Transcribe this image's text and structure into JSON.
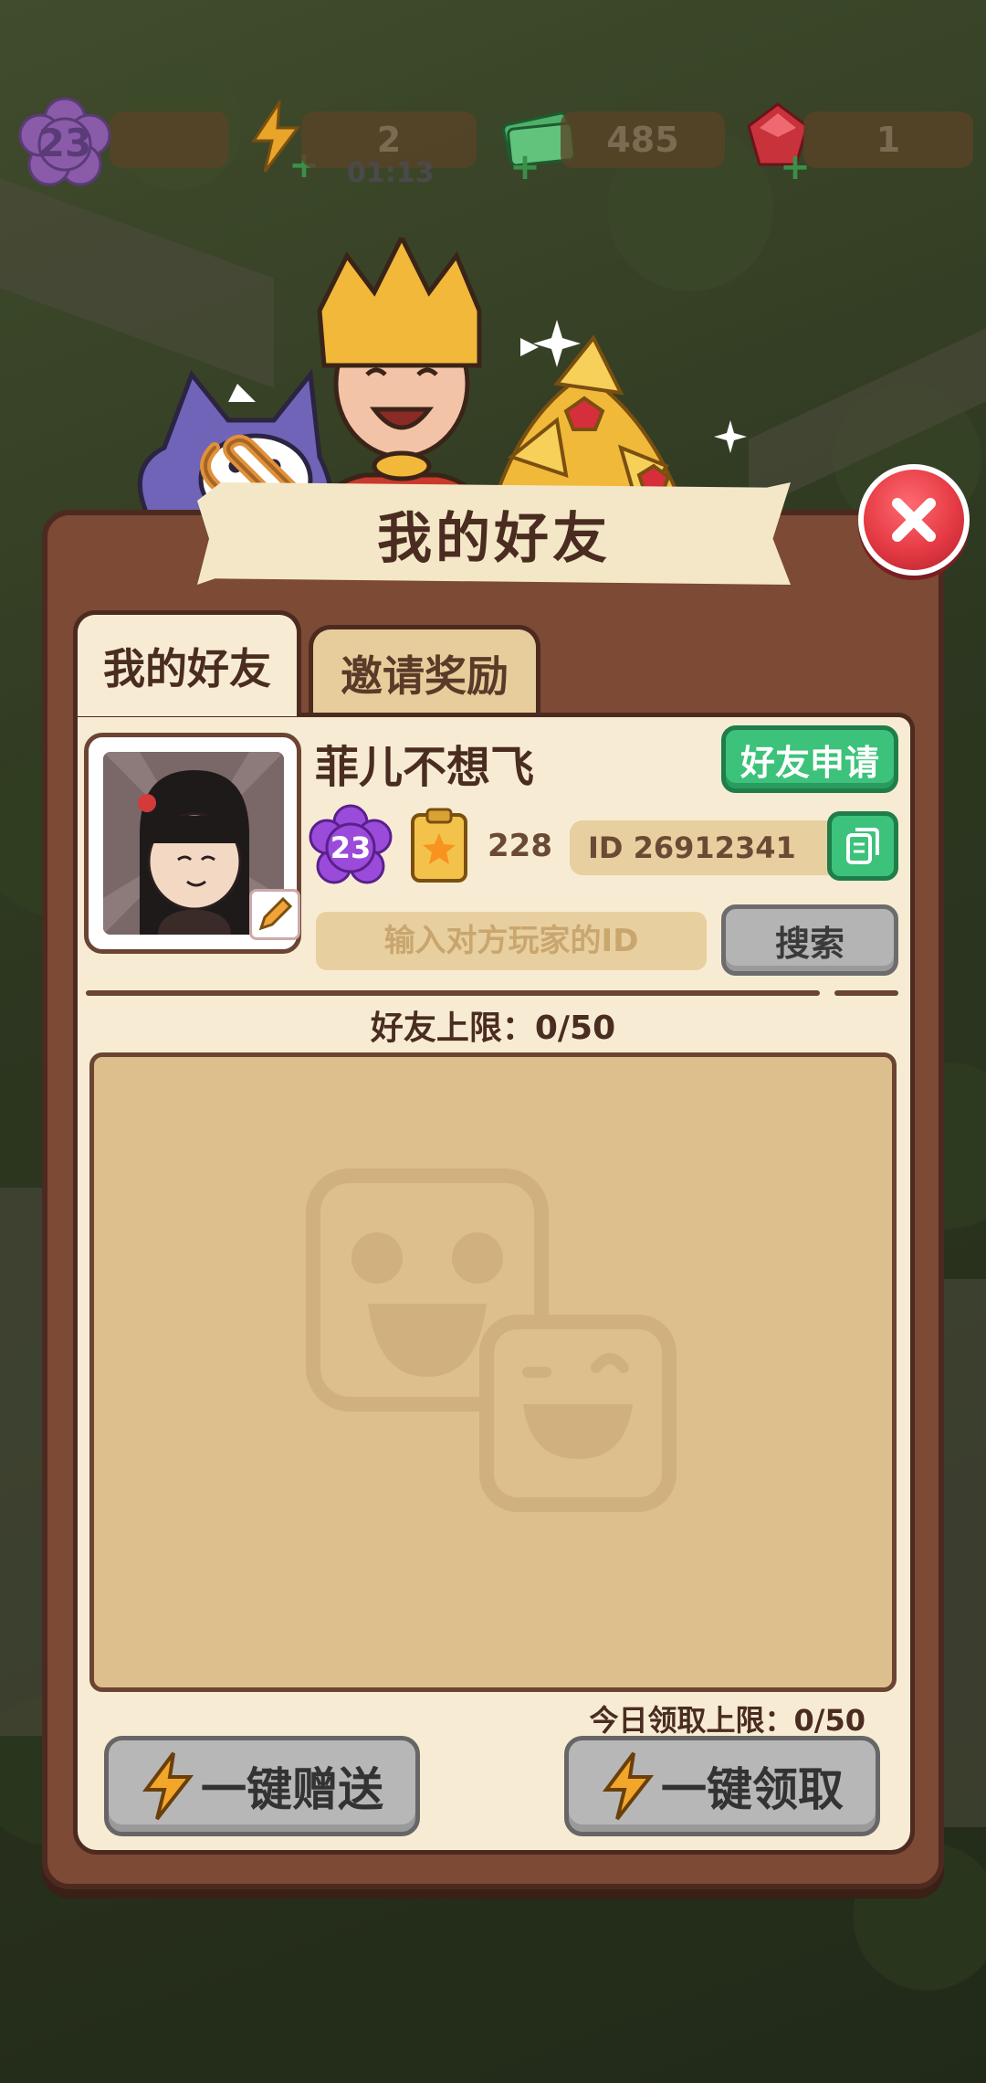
{
  "topbar": {
    "level": "23",
    "energy": "2",
    "energy_timer": "01:13",
    "cash": "485",
    "gems": "1"
  },
  "dialog": {
    "title": "我的好友",
    "tabs": [
      {
        "label": "我的好友",
        "active": true
      },
      {
        "label": "邀请奖励",
        "active": false
      }
    ]
  },
  "profile": {
    "name": "菲儿不想飞",
    "level": "23",
    "score": "228",
    "id_text": "ID 26912341",
    "friend_request_label": "好友申请"
  },
  "search": {
    "placeholder": "输入对方玩家的ID",
    "button_label": "搜索"
  },
  "friends": {
    "limit_text": "好友上限：0/50",
    "daily_limit_text": "今日领取上限：0/50"
  },
  "actions": {
    "send_all_label": "一键赠送",
    "claim_all_label": "一键领取"
  },
  "colors": {
    "panel": "#7c4a35",
    "panel_inner": "#f7ecd3",
    "green_button": "#3cc27a",
    "close_red": "#e53a44",
    "disabled_button": "#b7b7b7"
  }
}
